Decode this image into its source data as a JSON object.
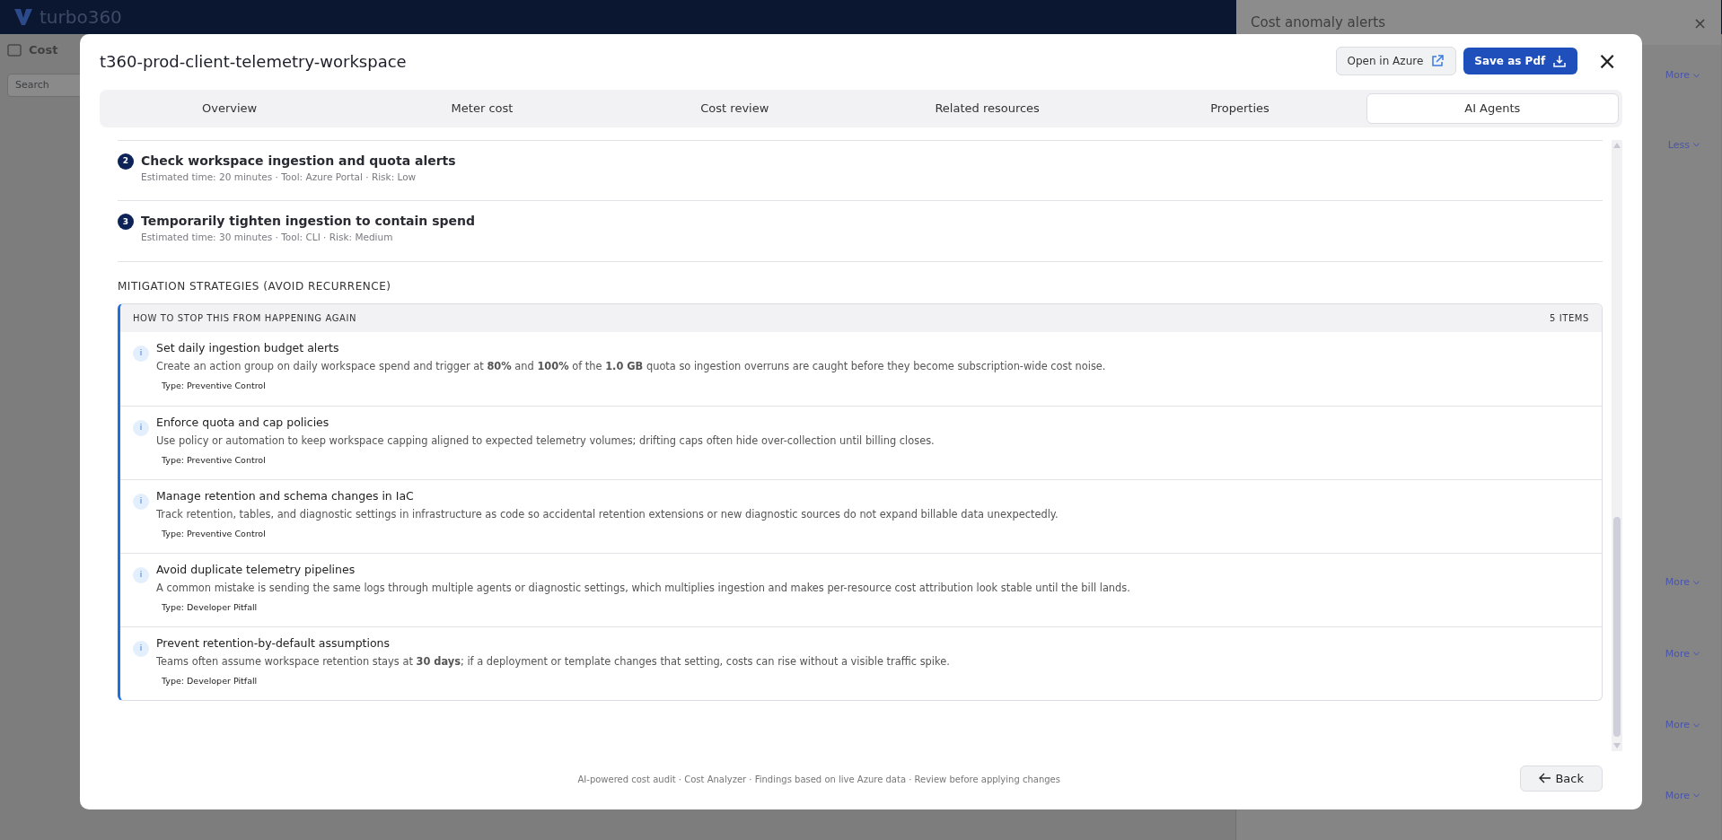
{
  "background": {
    "app_name": "turbo360",
    "page_title": "Cost",
    "search": {
      "placeholder": "Search"
    },
    "panel": {
      "title": "Cost anomaly alerts",
      "close": "×",
      "links": [
        {
          "label": "More"
        },
        {
          "label": "Less"
        },
        {
          "label": "More"
        },
        {
          "label": "More"
        },
        {
          "label": "More"
        },
        {
          "label": "More"
        }
      ]
    }
  },
  "modal": {
    "title": "t360-prod-client-telemetry-workspace",
    "buttons": [
      {
        "label": "Open in Azure",
        "kind": "secondary"
      },
      {
        "label": "Save as Pdf",
        "kind": "primary"
      }
    ],
    "close": "×",
    "tabs": [
      {
        "label": "Overview",
        "selected": false
      },
      {
        "label": "Meter cost",
        "selected": false
      },
      {
        "label": "Cost review",
        "selected": false
      },
      {
        "label": "Related resources",
        "selected": false
      },
      {
        "label": "Properties",
        "selected": false
      },
      {
        "label": "AI Agents",
        "selected": true
      }
    ],
    "steps": [
      {
        "number": "2",
        "title": "Check workspace ingestion and quota alerts",
        "meta": "Estimated time: 20 minutes · Tool: Azure Portal · Risk: Low"
      },
      {
        "number": "3",
        "title": "Temporarily tighten ingestion to contain spend",
        "meta": "Estimated time: 30 minutes · Tool: CLI · Risk: Medium"
      }
    ],
    "mitigation": {
      "heading": "MITIGATION STRATEGIES (AVOID RECURRENCE)",
      "card_title": "HOW TO STOP THIS FROM HAPPENING AGAIN",
      "count": "5 ITEMS",
      "items": [
        {
          "icon": "i",
          "title": "Set daily ingestion budget alerts",
          "text": "Create an action group on daily workspace spend and trigger at **80%** and **100%** of the **1.0 GB** quota so ingestion overruns are caught before they become subscription-wide cost noise.",
          "type": "Type: Preventive Control"
        },
        {
          "icon": "i",
          "title": "Enforce quota and cap policies",
          "text": "Use policy or automation to keep workspace capping aligned to expected telemetry volumes; drifting caps often hide over-collection until billing closes.",
          "type": "Type: Preventive Control"
        },
        {
          "icon": "i",
          "title": "Manage retention and schema changes in IaC",
          "text": "Track retention, tables, and diagnostic settings in infrastructure as code so accidental retention extensions or new diagnostic sources do not expand billable data unexpectedly.",
          "type": "Type: Preventive Control"
        },
        {
          "icon": "i",
          "title": "Avoid duplicate telemetry pipelines",
          "text": "A common mistake is sending the same logs through multiple agents or diagnostic settings, which multiplies ingestion and makes per-resource cost attribution look stable until the bill lands.",
          "type": "Type: Developer Pitfall"
        },
        {
          "icon": "i",
          "title": "Prevent retention-by-default assumptions",
          "text": "Teams often assume workspace retention stays at **30 days**; if a deployment or template changes that setting, costs can rise without a visible traffic spike.",
          "type": "Type: Developer Pitfall"
        }
      ]
    },
    "footer": "AI-powered cost audit · Cost Analyzer · Findings based on live Azure data · Review before applying changes",
    "back": "Back"
  }
}
